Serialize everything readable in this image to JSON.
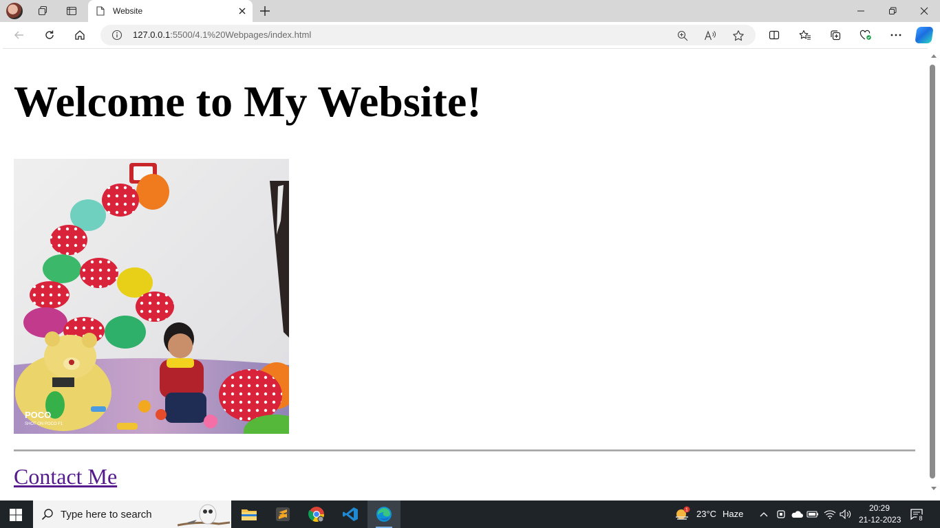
{
  "browser": {
    "tab": {
      "title": "Website"
    },
    "address": {
      "host": "127.0.0.1",
      "rest": ":5500/4.1%20Webpages/index.html"
    }
  },
  "page": {
    "heading": "Welcome to My Website!",
    "photo": {
      "watermark_brand": "POCO",
      "watermark_sub": "SHOT ON POCO F1"
    },
    "link": "Contact Me"
  },
  "taskbar": {
    "search_placeholder": "Type here to search",
    "weather": {
      "temp": "23°C",
      "condition": "Haze",
      "badge": "1"
    },
    "time": "20:29",
    "date": "21-12-2023",
    "notifications": "8"
  },
  "colors": {
    "link_visited": "#551a8b",
    "taskbar": "#1f2429",
    "tabstrip": "#d7d7d7"
  }
}
